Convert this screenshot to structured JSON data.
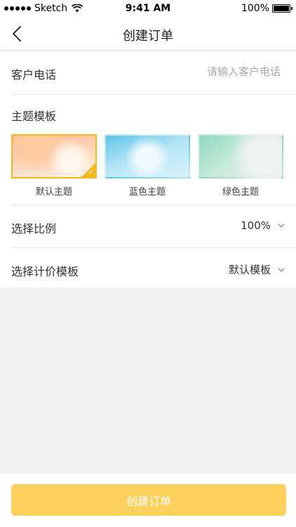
{
  "status_bar": {
    "carrier": "Sketch",
    "time": "9:41 AM",
    "battery_percent": "100%"
  },
  "nav": {
    "title": "创建订单",
    "back_icon": "chevron-left-icon"
  },
  "form": {
    "phone": {
      "label": "客户电话",
      "value": "",
      "placeholder": "请输入客户电话"
    },
    "theme": {
      "label": "主题模板",
      "options": [
        {
          "label": "默认主题",
          "selected": true
        },
        {
          "label": "蓝色主题",
          "selected": false
        },
        {
          "label": "绿色主题",
          "selected": false
        }
      ]
    },
    "ratio": {
      "label": "选择比例",
      "value": "100%"
    },
    "price_template": {
      "label": "选择计价模板",
      "value": "默认模板"
    }
  },
  "submit": {
    "label": "创建订单"
  },
  "colors": {
    "accent": "#f5b920",
    "button_bg": "#ffd15c",
    "page_bg": "#f2f2f2"
  }
}
